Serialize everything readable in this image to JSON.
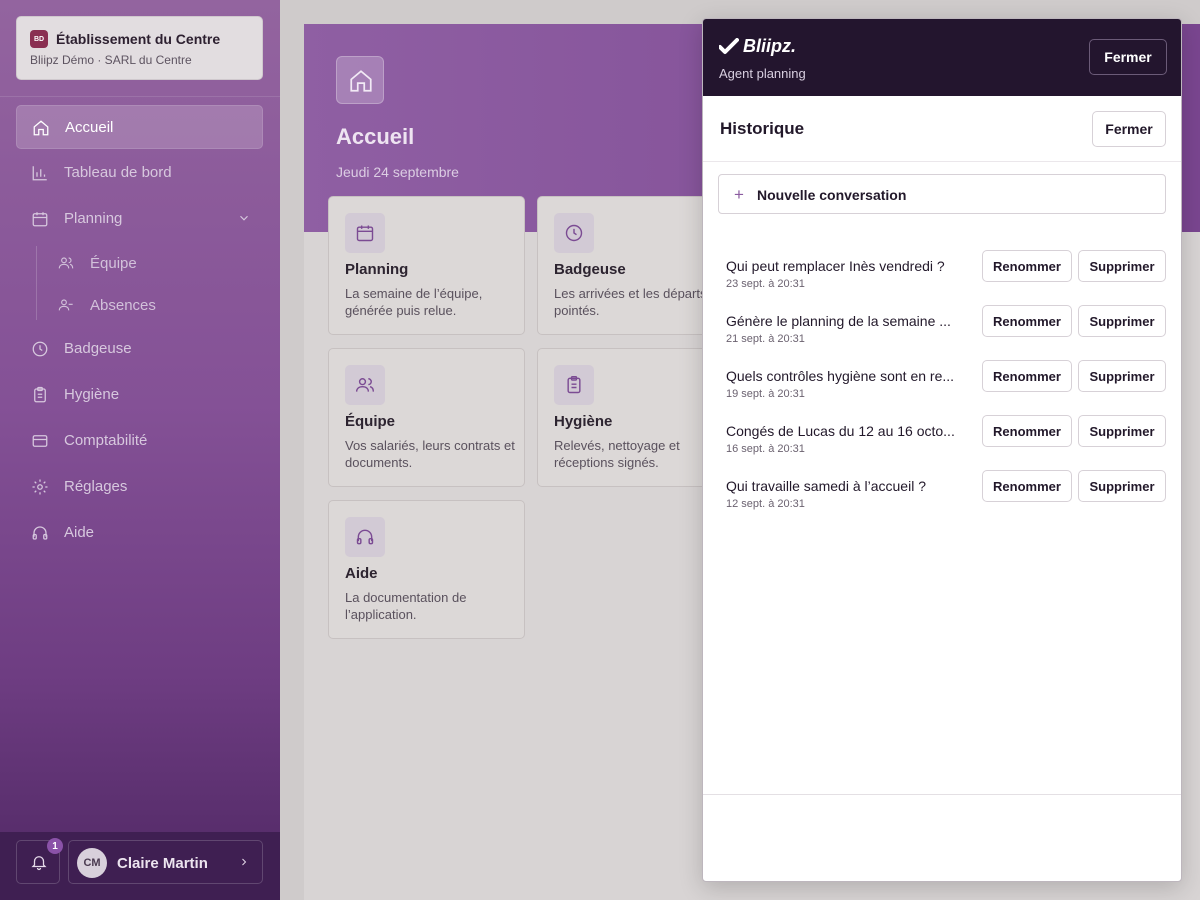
{
  "org": {
    "badge": "BD",
    "name": "Établissement du Centre",
    "sub": "Bliipz Démo · SARL du Centre"
  },
  "sidebar": {
    "items": [
      {
        "label": "Accueil"
      },
      {
        "label": "Tableau de bord"
      },
      {
        "label": "Planning"
      },
      {
        "label": "Badgeuse"
      },
      {
        "label": "Hygiène"
      },
      {
        "label": "Comptabilité"
      },
      {
        "label": "Réglages"
      },
      {
        "label": "Aide"
      }
    ],
    "sub_items": [
      {
        "label": "Équipe"
      },
      {
        "label": "Absences"
      }
    ]
  },
  "footer": {
    "notification_count": "1",
    "user_initials": "CM",
    "user_name": "Claire Martin"
  },
  "main": {
    "title": "Accueil",
    "date": "Jeudi 24 septembre",
    "cards": [
      {
        "title": "Planning",
        "desc": "La semaine de l’équipe, générée puis relue."
      },
      {
        "title": "Badgeuse",
        "desc": "Les arrivées et les départs pointés."
      },
      {
        "title": "Équipe",
        "desc": "Vos salariés, leurs contrats et documents."
      },
      {
        "title": "Hygiène",
        "desc": "Relevés, nettoyage et réceptions signés."
      },
      {
        "title": "Aide",
        "desc": "La documentation de l’application."
      }
    ]
  },
  "panel": {
    "brand": "Bliipz.",
    "subtitle": "Agent planning",
    "close_label": "Fermer",
    "history_title": "Historique",
    "history_close_label": "Fermer",
    "new_conversation": "Nouvelle conversation",
    "rename_label": "Renommer",
    "delete_label": "Supprimer",
    "conversations": [
      {
        "title": "Qui peut remplacer Inès vendredi ?",
        "date": "23 sept. à 20:31"
      },
      {
        "title": "Génère le planning de la semaine ...",
        "date": "21 sept. à 20:31"
      },
      {
        "title": "Quels contrôles hygiène sont en re...",
        "date": "19 sept. à 20:31"
      },
      {
        "title": "Congés de Lucas du 12 au 16 octo...",
        "date": "16 sept. à 20:31"
      },
      {
        "title": "Qui travaille samedi à l’accueil ?",
        "date": "12 sept. à 20:31"
      }
    ]
  }
}
